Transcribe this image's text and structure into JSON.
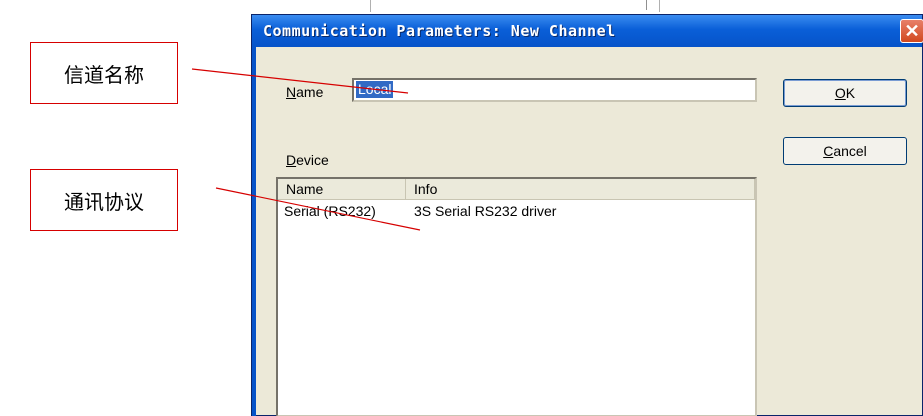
{
  "callouts": {
    "channel_name": "信道名称",
    "protocol": "通讯协议"
  },
  "dialog": {
    "title": "Communication Parameters: New Channel",
    "close_glyph": "✕",
    "name_label_hotkey": "N",
    "name_label_rest": "ame",
    "name_value": "Local",
    "device_label_hotkey": "D",
    "device_label_rest": "evice",
    "ok_hotkey": "O",
    "ok_rest": "K",
    "cancel_hotkey": "C",
    "cancel_rest": "ancel",
    "device_list": {
      "columns": [
        "Name",
        "Info"
      ],
      "rows": [
        {
          "name": "Serial (RS232)",
          "info": "3S Serial RS232 driver"
        }
      ]
    }
  },
  "colors": {
    "titlebar": "#0653c9",
    "dialog_bg": "#ece9d8",
    "callout_border": "#d60000",
    "selection": "#316ac5"
  }
}
